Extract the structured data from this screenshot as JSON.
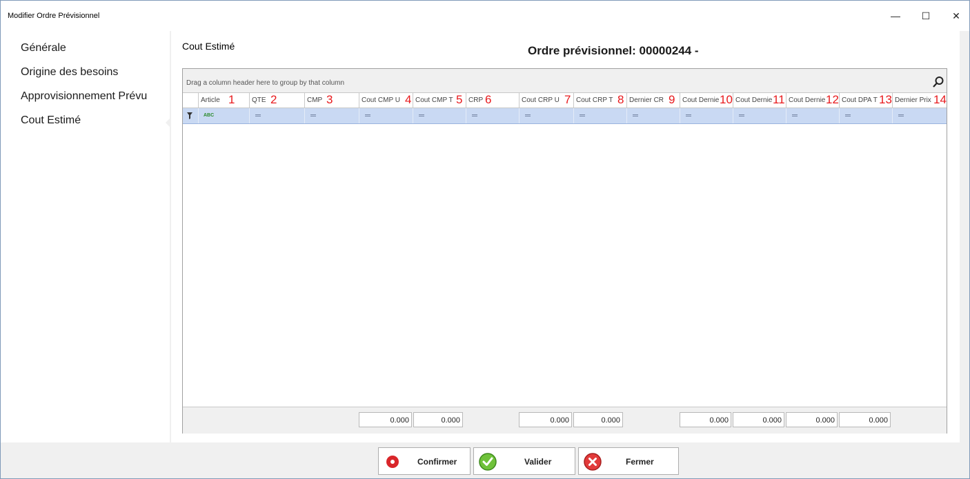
{
  "window": {
    "title": "Modifier Ordre  Prévisionnel",
    "minimize_glyph": "—",
    "maximize_glyph": "☐",
    "close_glyph": "✕"
  },
  "sidebar": {
    "items": [
      {
        "label": "Générale"
      },
      {
        "label": "Origine des besoins"
      },
      {
        "label": "Approvisionnement Prévu"
      },
      {
        "label": "Cout Estimé"
      }
    ],
    "selected_index": 3
  },
  "content": {
    "section_title": "Cout Estimé",
    "order_title": "Ordre prévisionnel: 00000244 -"
  },
  "grid": {
    "group_panel_text": "Drag a column header here to group by that column",
    "columns": [
      {
        "label": "Article",
        "number": "1"
      },
      {
        "label": "QTE",
        "number": "2"
      },
      {
        "label": "CMP",
        "number": "3"
      },
      {
        "label": "Cout CMP U",
        "number": "4"
      },
      {
        "label": "Cout CMP T",
        "number": "5"
      },
      {
        "label": "CRP",
        "number": "6"
      },
      {
        "label": "Cout CRP U",
        "number": "7"
      },
      {
        "label": "Cout CRP T",
        "number": "8"
      },
      {
        "label": "Dernier CR",
        "number": "9"
      },
      {
        "label": "Cout Dernie",
        "number": "10"
      },
      {
        "label": "Cout Dernie",
        "number": "11"
      },
      {
        "label": "Cout Dernie",
        "number": "12"
      },
      {
        "label": "Cout DPA T",
        "number": "13"
      },
      {
        "label": "Dernier Prix",
        "number": "14"
      }
    ],
    "totals": {
      "cout_cmp_u": "0.000",
      "cout_cmp_t": "0.000",
      "cout_crp_u": "0.000",
      "cout_crp_t": "0.000",
      "cout_dernier_1": "0.000",
      "cout_dernier_2": "0.000",
      "cout_dernier_3": "0.000",
      "cout_dpa_t": "0.000"
    }
  },
  "buttons": {
    "confirmer": "Confirmer",
    "valider": "Valider",
    "fermer": "Fermer"
  },
  "colors": {
    "filter_row": "#c9d9f3",
    "column_number": "#e8191c",
    "confirm_icon": "#d9262a",
    "valider_icon": "#5cb030",
    "fermer_icon": "#e23a3a"
  }
}
